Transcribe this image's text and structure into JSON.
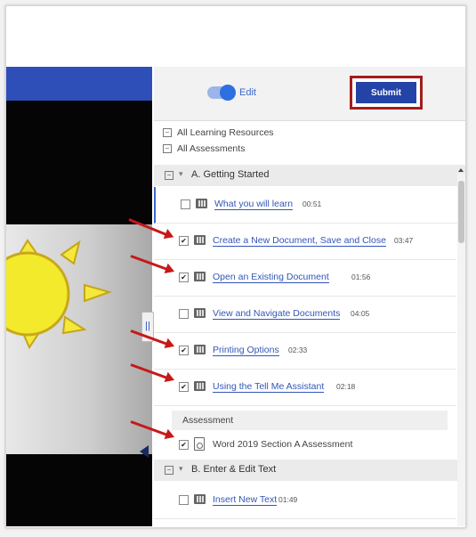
{
  "toolbar": {
    "edit_label": "Edit",
    "submit_label": "Submit"
  },
  "filters": [
    "All Learning Resources",
    "All Assessments"
  ],
  "sections": [
    {
      "title": "A. Getting Started"
    },
    {
      "title": "B. Enter & Edit Text"
    }
  ],
  "items": [
    {
      "title": "What you will learn",
      "duration": "00:51",
      "checked": false
    },
    {
      "title": "Create a New Document, Save and Close",
      "duration": "03:47",
      "checked": true
    },
    {
      "title": "Open an Existing Document",
      "duration": "01:56",
      "checked": true
    },
    {
      "title": "View and Navigate Documents",
      "duration": "04:05",
      "checked": false
    },
    {
      "title": "Printing Options",
      "duration": "02:33",
      "checked": true
    },
    {
      "title": "Using the Tell Me Assistant",
      "duration": "02:18",
      "checked": true
    }
  ],
  "assessment": {
    "header": "Assessment",
    "title": "Word 2019 Section A Assessment",
    "checked": true
  },
  "section_b_items": [
    {
      "title": "Insert New Text",
      "duration": "01:49",
      "checked": false
    }
  ],
  "colors": {
    "accent": "#2343a6",
    "highlight_border": "#a51c1c",
    "arrow": "#c81818",
    "link": "#3356b8"
  }
}
